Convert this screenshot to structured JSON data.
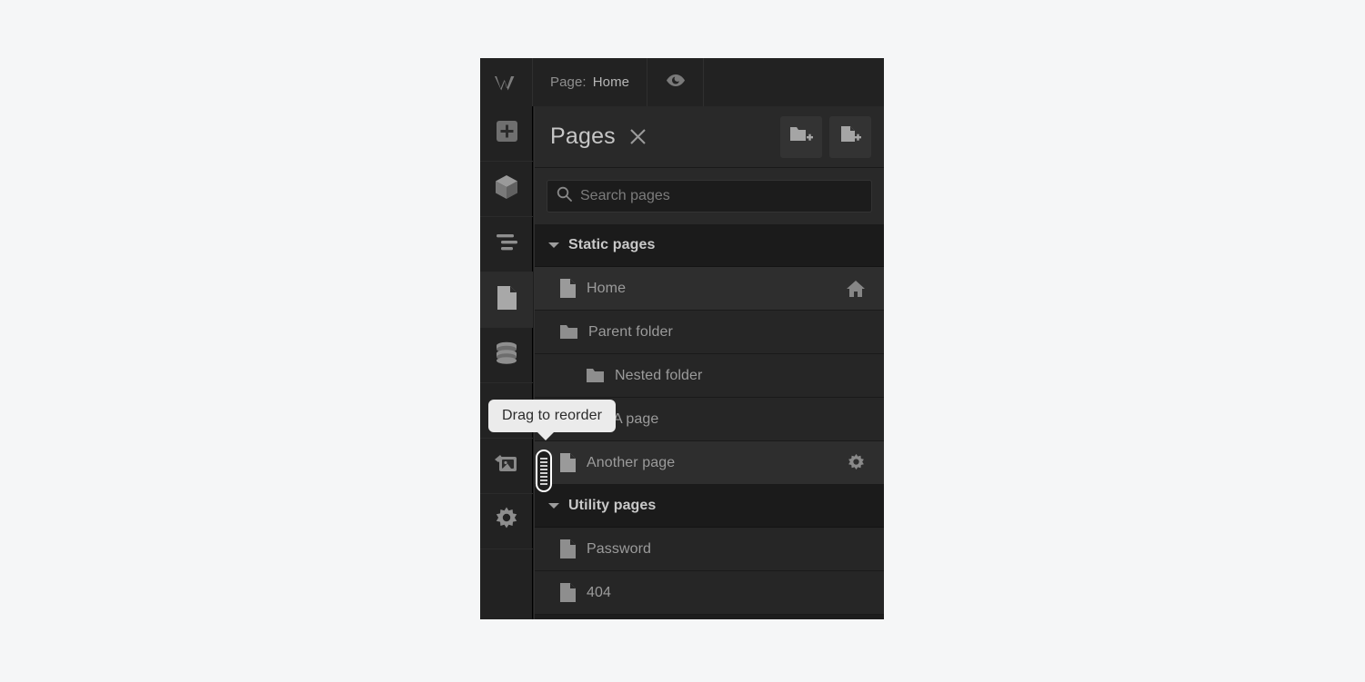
{
  "topbar": {
    "logo_icon": "webflow-logo-icon",
    "page_label": "Page:",
    "page_value": "Home",
    "preview_icon": "eye-icon"
  },
  "rail": {
    "items": [
      {
        "name": "add-panel",
        "icon": "plus-square-icon",
        "active": false
      },
      {
        "name": "components-panel",
        "icon": "cube-icon",
        "active": false
      },
      {
        "name": "navigator-panel",
        "icon": "navigator-lines-icon",
        "active": false
      },
      {
        "name": "pages-panel",
        "icon": "page-document-icon",
        "active": true
      },
      {
        "name": "cms-panel",
        "icon": "database-icon",
        "active": false
      },
      {
        "name": "ecommerce-panel",
        "icon": "cart-icon",
        "active": false
      },
      {
        "name": "assets-panel",
        "icon": "images-icon",
        "active": false
      },
      {
        "name": "settings-panel",
        "icon": "gear-icon",
        "active": false
      }
    ]
  },
  "panel": {
    "title": "Pages",
    "close_icon": "close-icon",
    "add_folder_icon": "folder-plus-icon",
    "add_page_icon": "page-plus-icon",
    "search": {
      "icon": "search-icon",
      "placeholder": "Search pages",
      "value": ""
    },
    "sections": [
      {
        "title": "Static pages",
        "caret_icon": "caret-down-icon",
        "rows": [
          {
            "label": "Home",
            "icon": "page-icon",
            "indent": 1,
            "action_icon": "home-icon",
            "hover": true
          },
          {
            "label": "Parent folder",
            "icon": "folder-icon",
            "indent": 1,
            "action_icon": "",
            "hover": false
          },
          {
            "label": "Nested folder",
            "icon": "folder-icon",
            "indent": 2,
            "action_icon": "",
            "hover": false
          },
          {
            "label": "A page",
            "icon": "page-icon",
            "indent": 2,
            "action_icon": "",
            "hover": false
          },
          {
            "label": "Another page",
            "icon": "page-icon",
            "indent": 1,
            "action_icon": "gear-icon",
            "hover": true
          }
        ]
      },
      {
        "title": "Utility pages",
        "caret_icon": "caret-down-icon",
        "rows": [
          {
            "label": "Password",
            "icon": "page-icon",
            "indent": 1,
            "action_icon": "",
            "hover": false
          },
          {
            "label": "404",
            "icon": "page-icon",
            "indent": 1,
            "action_icon": "",
            "hover": false
          }
        ]
      }
    ]
  },
  "tooltip": {
    "text": "Drag to reorder"
  },
  "drag_handle": {
    "name": "drag-handle",
    "ridge_count": 8
  },
  "colors": {
    "page_background": "#f5f6f7",
    "chrome": "#222222",
    "panel": "#1d1d1d",
    "panel_header": "#292929",
    "row": "#262626",
    "row_hover": "#2e2e2e",
    "section_header": "#1b1b1b",
    "text": "#9b9b9b",
    "tooltip_bg": "#ebebeb"
  }
}
